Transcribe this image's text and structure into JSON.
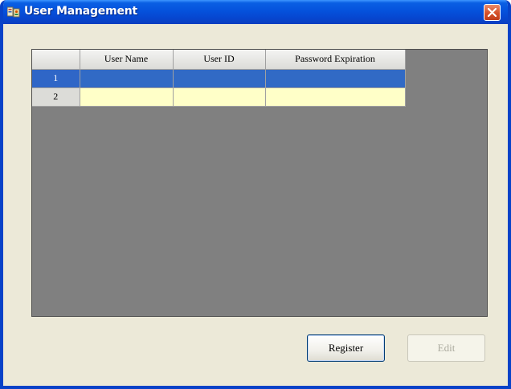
{
  "window": {
    "title": "User Management",
    "icon": "user-management-app-icon",
    "close_icon": "close-icon"
  },
  "grid": {
    "columns": [
      "User Name",
      "User ID",
      "Password Expiration"
    ],
    "rows": [
      {
        "number": "1",
        "user_name": "",
        "user_id": "",
        "password_expiration": "",
        "selected": true
      },
      {
        "number": "2",
        "user_name": "",
        "user_id": "",
        "password_expiration": "",
        "selected": false
      }
    ],
    "colors": {
      "selected_row": "#316ac5",
      "new_row": "#ffffc8",
      "empty_area": "#808080"
    }
  },
  "buttons": {
    "register_label": "Register",
    "edit_label": "Edit",
    "edit_enabled": false
  }
}
